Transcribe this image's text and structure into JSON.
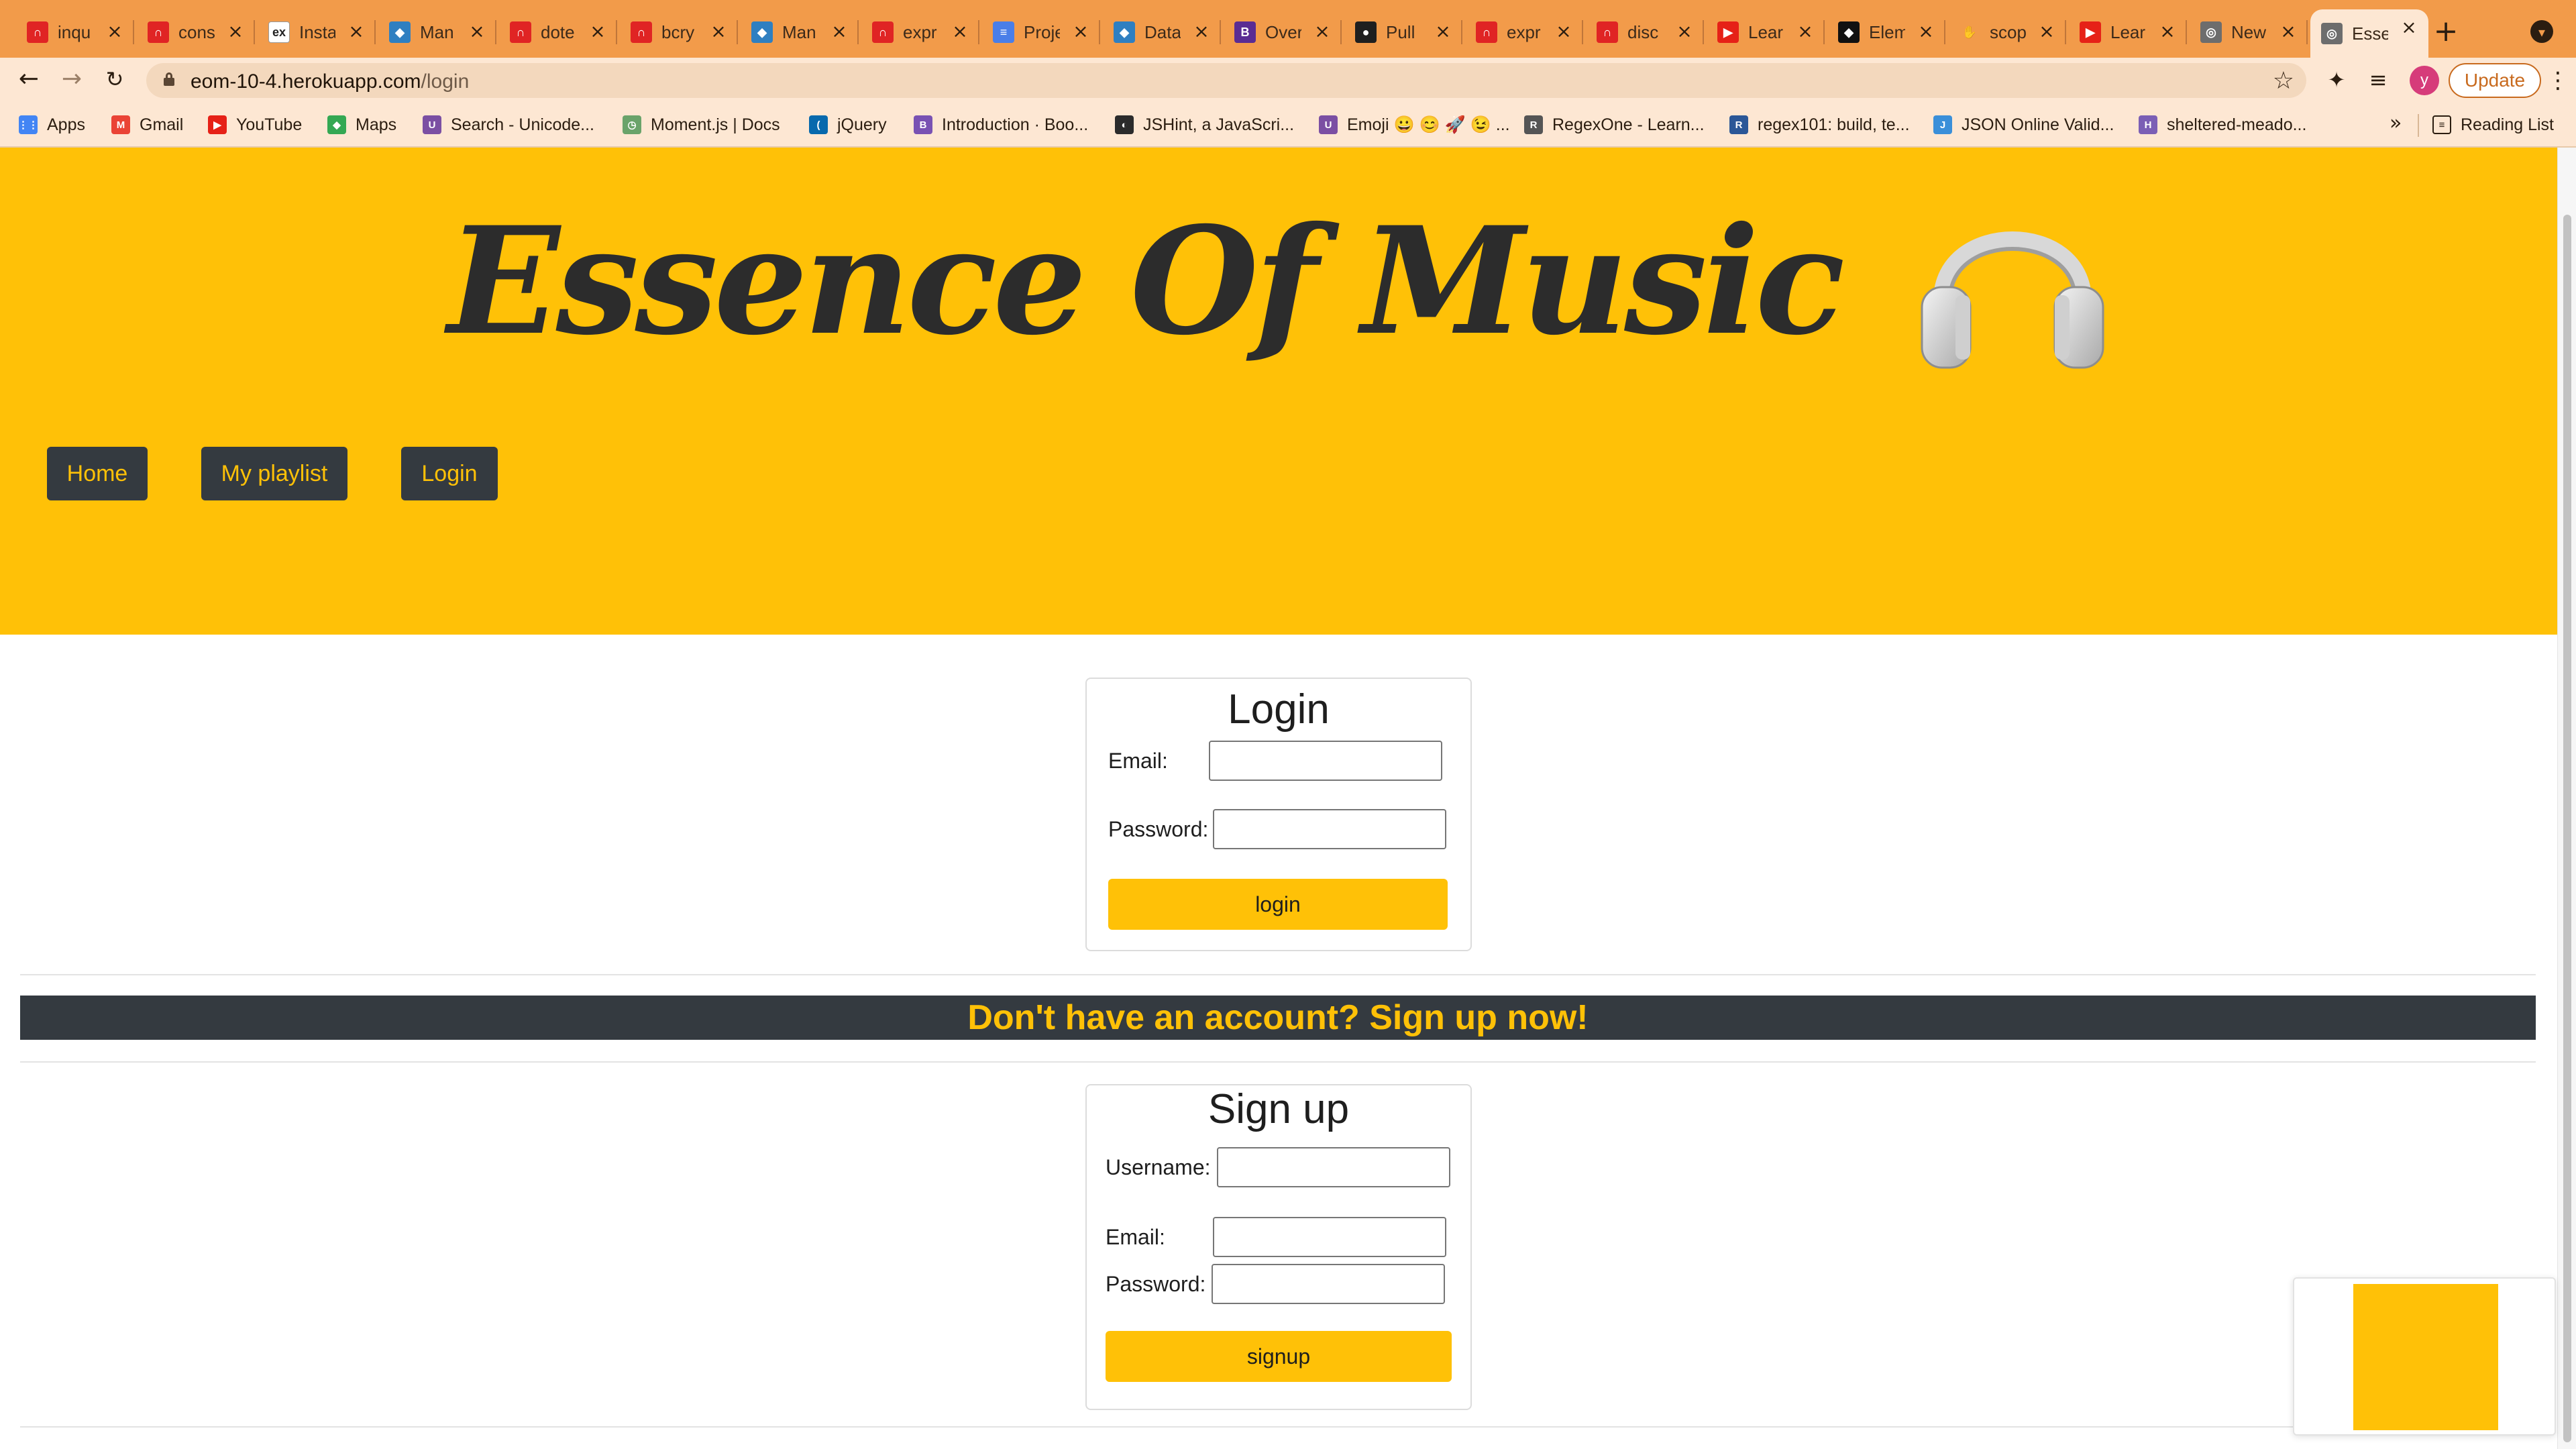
{
  "browser": {
    "tabs": [
      {
        "title": "inqu",
        "icon": "app-icon",
        "color": "#e02424",
        "glyph": "∩"
      },
      {
        "title": "cons",
        "icon": "app-icon",
        "color": "#e02424",
        "glyph": "∩"
      },
      {
        "title": "Insta",
        "icon": "ex-icon",
        "color": "#ffffff",
        "glyph": "ex"
      },
      {
        "title": "Man",
        "icon": "cube-icon",
        "color": "#2f7fc1",
        "glyph": "◆"
      },
      {
        "title": "dote",
        "icon": "app-icon",
        "color": "#e02424",
        "glyph": "∩"
      },
      {
        "title": "bcry",
        "icon": "app-icon",
        "color": "#e02424",
        "glyph": "∩"
      },
      {
        "title": "Man",
        "icon": "cube-icon",
        "color": "#2f7fc1",
        "glyph": "◆"
      },
      {
        "title": "expr",
        "icon": "app-icon",
        "color": "#e02424",
        "glyph": "∩"
      },
      {
        "title": "Proje",
        "icon": "docs-icon",
        "color": "#4a7ee8",
        "glyph": "≡"
      },
      {
        "title": "Data",
        "icon": "cube-icon",
        "color": "#2f7fc1",
        "glyph": "◆"
      },
      {
        "title": "Over",
        "icon": "bootstrap-icon",
        "color": "#5a2c93",
        "glyph": "B"
      },
      {
        "title": "Pull",
        "icon": "github-icon",
        "color": "#1f1f1f",
        "glyph": "●"
      },
      {
        "title": "expr",
        "icon": "app-icon",
        "color": "#e02424",
        "glyph": "∩"
      },
      {
        "title": "disc",
        "icon": "app-icon",
        "color": "#e02424",
        "glyph": "∩"
      },
      {
        "title": "Lear",
        "icon": "youtube-icon",
        "color": "#e62117",
        "glyph": "▶"
      },
      {
        "title": "Elem",
        "icon": "elem-icon",
        "color": "#111111",
        "glyph": "◆"
      },
      {
        "title": "scop",
        "icon": "scope-icon",
        "color": "#f29b4a",
        "glyph": "✋"
      },
      {
        "title": "Lear",
        "icon": "youtube-icon",
        "color": "#e62117",
        "glyph": "▶"
      },
      {
        "title": "New",
        "icon": "chrome-icon",
        "color": "#6d6d6d",
        "glyph": "◎"
      },
      {
        "title": "Esse",
        "icon": "globe-icon",
        "color": "#6d6d6d",
        "glyph": "◎",
        "active": true
      }
    ],
    "url_host": "eom-10-4.herokuapp.com",
    "url_path": "/login",
    "update_label": "Update",
    "profile_initial": "y",
    "bookmarks": [
      {
        "label": "Apps",
        "icon": "apps-grid-icon",
        "color": "#4285f4",
        "glyph": "⋮⋮"
      },
      {
        "label": "Gmail",
        "icon": "gmail-icon",
        "color": "#ea4335",
        "glyph": "M"
      },
      {
        "label": "YouTube",
        "icon": "youtube-icon",
        "color": "#e62117",
        "glyph": "▶"
      },
      {
        "label": "Maps",
        "icon": "maps-icon",
        "color": "#34a853",
        "glyph": "◆"
      },
      {
        "label": "Search - Unicode...",
        "icon": "unicode-icon",
        "color": "#7b4fa3",
        "glyph": "U"
      },
      {
        "label": "Moment.js | Docs",
        "icon": "moment-icon",
        "color": "#6aa36a",
        "glyph": "◷"
      },
      {
        "label": "jQuery",
        "icon": "jquery-icon",
        "color": "#0769ad",
        "glyph": "("
      },
      {
        "label": "Introduction · Boo...",
        "icon": "bootstrap-icon",
        "color": "#7952b3",
        "glyph": "B"
      },
      {
        "label": "JSHint, a JavaScri...",
        "icon": "jshint-icon",
        "color": "#2b2b2b",
        "glyph": "◐"
      },
      {
        "label": "Emoji 😀 😊 🚀 😉 ...",
        "icon": "unicode-icon",
        "color": "#7b4fa3",
        "glyph": "U"
      },
      {
        "label": "RegexOne - Learn...",
        "icon": "regexone-icon",
        "color": "#555555",
        "glyph": "R"
      },
      {
        "label": "regex101: build, te...",
        "icon": "regex101-icon",
        "color": "#2b5797",
        "glyph": "R"
      },
      {
        "label": "JSON Online Valid...",
        "icon": "json-icon",
        "color": "#3a8fd9",
        "glyph": "J"
      },
      {
        "label": "sheltered-meado...",
        "icon": "heroku-icon",
        "color": "#7b5fb5",
        "glyph": "H"
      }
    ],
    "bookmarks_more": "»",
    "reading_list": "Reading List"
  },
  "site": {
    "title": "Essence Of Music",
    "hero_color": "#ffc107",
    "dark_color": "#343a40",
    "nav": [
      "Home",
      "My playlist",
      "Login"
    ]
  },
  "login": {
    "title": "Login",
    "email_label": "Email:",
    "password_label": "Password:",
    "button": "login",
    "email_value": "",
    "password_value": ""
  },
  "banner": {
    "text": "Don't have an account? Sign up now!"
  },
  "signup": {
    "title": "Sign up",
    "username_label": "Username:",
    "email_label": "Email:",
    "password_label": "Password:",
    "button": "signup",
    "username_value": "",
    "email_value": "",
    "password_value": ""
  }
}
